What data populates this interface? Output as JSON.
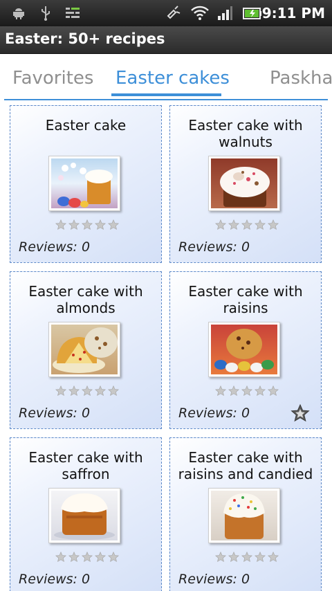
{
  "status_bar": {
    "time": "9:11 PM",
    "icons": [
      "android-icon",
      "usb-icon",
      "sync-icon",
      "bluetooth-icon",
      "wifi-icon",
      "signal-icon",
      "battery-icon"
    ]
  },
  "app": {
    "title": "Easter: 50+ recipes"
  },
  "tabs": [
    {
      "label": "Favorites",
      "selected": false
    },
    {
      "label": "Easter cakes",
      "selected": true
    },
    {
      "label": "Paskha",
      "selected": false
    }
  ],
  "colors": {
    "accent": "#3d8fd8",
    "card_border": "#5b88c8",
    "inactive_tab": "#8f8f8f"
  },
  "recipes": [
    {
      "title": "Easter cake",
      "photo": "easter-cake-photo",
      "rating": 0,
      "reviews": "Reviews: 0",
      "favorite": false
    },
    {
      "title": "Easter cake with walnuts",
      "photo": "walnut-cake-photo",
      "rating": 0,
      "reviews": "Reviews: 0",
      "favorite": false
    },
    {
      "title": "Easter cake with almonds",
      "photo": "almond-cake-photo",
      "rating": 0,
      "reviews": "Reviews: 0",
      "favorite": false
    },
    {
      "title": "Easter cake with raisins",
      "photo": "raisin-cake-photo",
      "rating": 0,
      "reviews": "Reviews: 0",
      "favorite": true
    },
    {
      "title": "Easter cake with saffron",
      "photo": "saffron-cake-photo",
      "rating": 0,
      "reviews": "Reviews: 0",
      "favorite": false
    },
    {
      "title": "Easter cake with raisins and candied",
      "photo": "candied-cake-photo",
      "rating": 0,
      "reviews": "Reviews: 0",
      "favorite": false
    }
  ]
}
